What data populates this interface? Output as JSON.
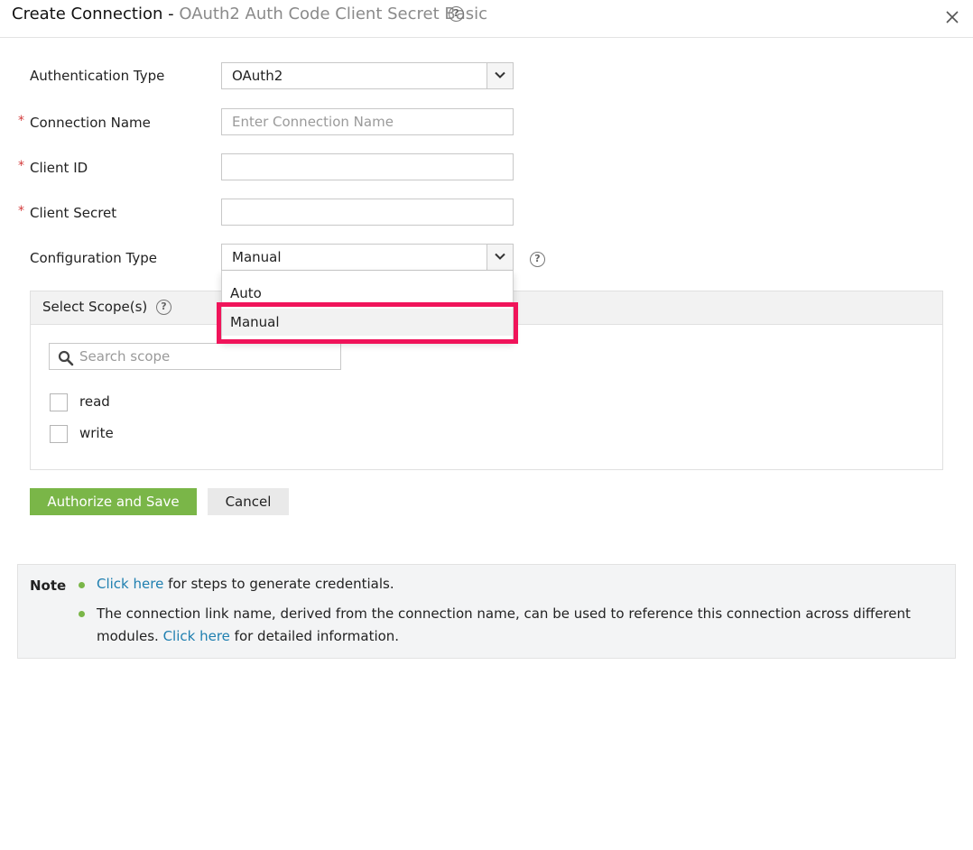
{
  "header": {
    "title": "Create Connection",
    "separator": " - ",
    "subtitle": "OAuth2 Auth Code Client Secret Basic",
    "help_icon": "question-circle-icon",
    "close_icon": "close-icon"
  },
  "form": {
    "required_marker": "*",
    "auth_type": {
      "label": "Authentication Type",
      "value": "OAuth2"
    },
    "connection_name": {
      "label": "Connection Name",
      "placeholder": "Enter Connection Name",
      "value": ""
    },
    "client_id": {
      "label": "Client ID",
      "value": ""
    },
    "client_secret": {
      "label": "Client Secret",
      "value": ""
    },
    "config_type": {
      "label": "Configuration Type",
      "value": "Manual",
      "options": [
        "Auto",
        "Manual"
      ]
    }
  },
  "scopes": {
    "title": "Select Scope(s)",
    "search_placeholder": "Search scope",
    "items": [
      {
        "label": "read",
        "checked": false
      },
      {
        "label": "write",
        "checked": false
      }
    ]
  },
  "buttons": {
    "primary": "Authorize and Save",
    "secondary": "Cancel"
  },
  "note": {
    "title": "Note",
    "line1_link": "Click here",
    "line1_text": " for steps to generate credentials.",
    "line2a": "The connection link name, derived from the connection name, can be used to reference this connection across different",
    "line2b_prefix": "modules. ",
    "line2b_link": "Click here",
    "line2b_suffix": " for detailed information."
  },
  "colors": {
    "primary_button": "#7ab648",
    "highlight": "#f0145a",
    "link": "#1f7fb0",
    "required": "#d33b3b"
  }
}
